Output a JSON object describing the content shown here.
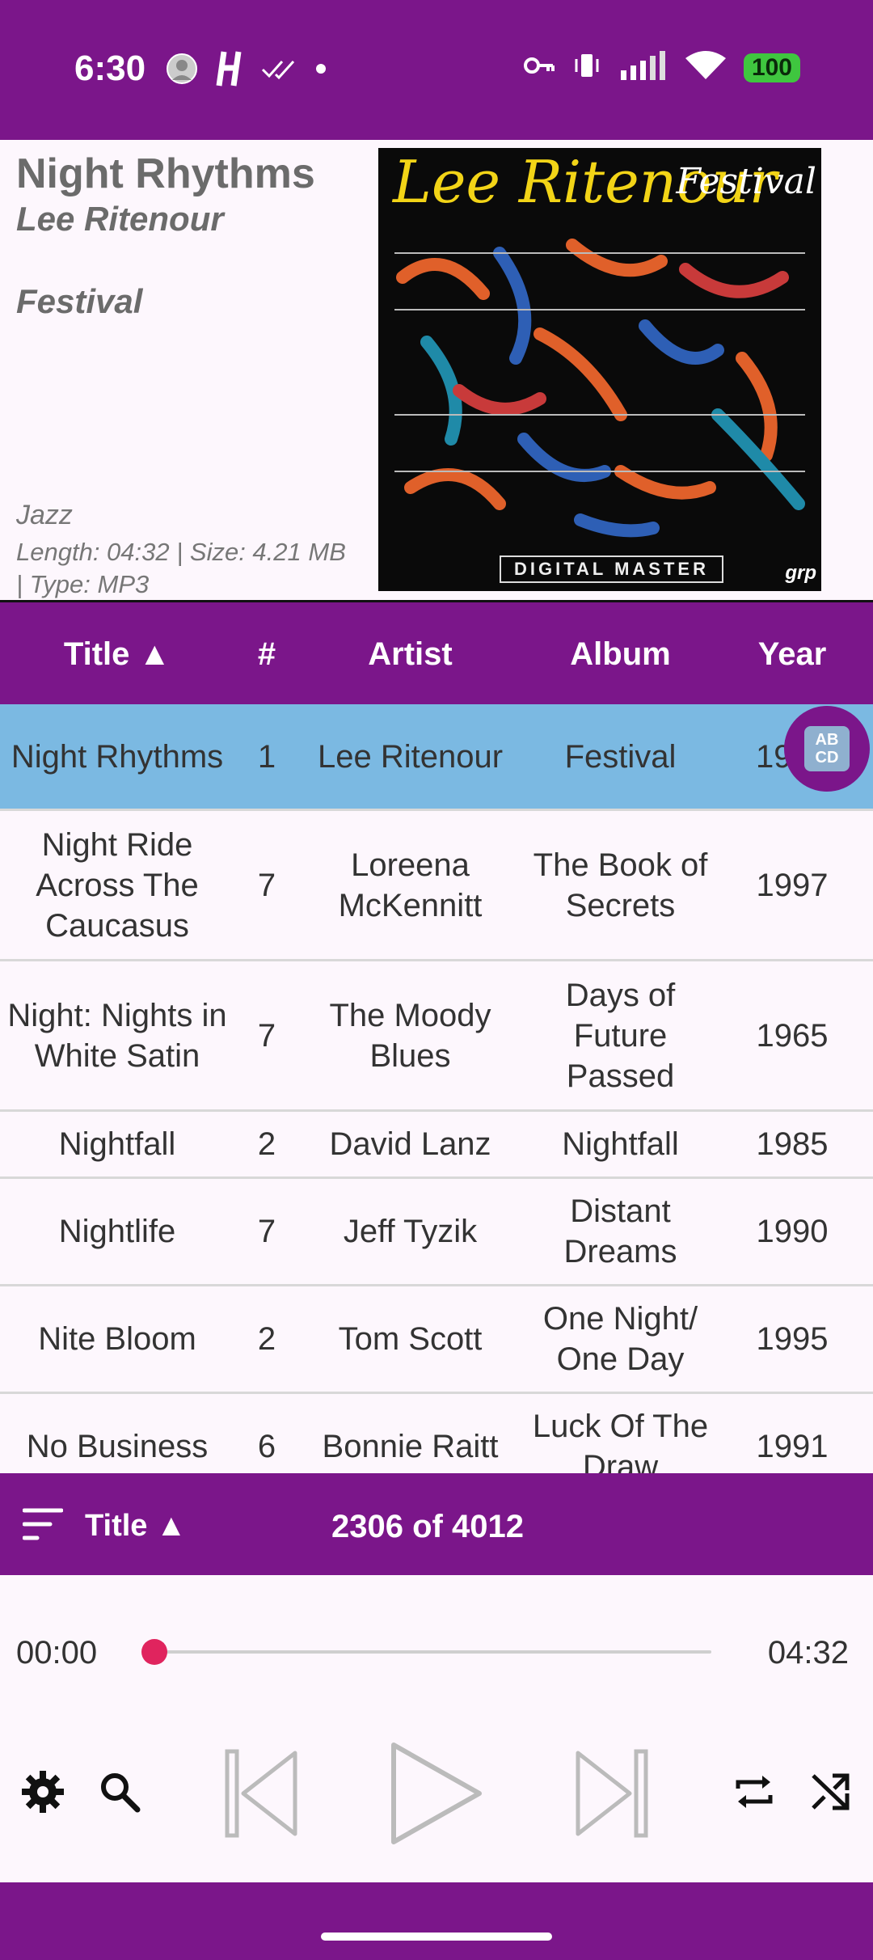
{
  "status_bar": {
    "time": "6:30",
    "battery": "100",
    "icons": [
      "avatar-icon",
      "h-icon",
      "double-check-icon",
      "dot-icon",
      "key-icon",
      "vibrate-icon",
      "signal-icon",
      "wifi-icon",
      "battery-icon",
      "charging-icon"
    ]
  },
  "now_playing": {
    "title": "Night Rhythms",
    "artist": "Lee Ritenour",
    "album": "Festival",
    "genre": "Jazz",
    "meta": "Length: 04:32  |  Size: 4.21 MB  |  Type: MP3",
    "cover": {
      "artist_text": "Lee Ritenour",
      "album_text": "Festival",
      "badge": "DIGITAL MASTER",
      "logo": "grp"
    }
  },
  "table": {
    "columns": [
      "Title ▲",
      "#",
      "Artist",
      "Album",
      "Year"
    ],
    "rows": [
      {
        "title": "Night Rhythms",
        "num": "1",
        "artist": "Lee Ritenour",
        "album": "Festival",
        "year": "19"
      },
      {
        "title": "Night Ride Across The Caucasus",
        "num": "7",
        "artist": "Loreena McKennitt",
        "album": "The Book of Secrets",
        "year": "1997"
      },
      {
        "title": "Night: Nights in White Satin",
        "num": "7",
        "artist": "The Moody Blues",
        "album": "Days of Future Passed",
        "year": "1965"
      },
      {
        "title": "Nightfall",
        "num": "2",
        "artist": "David Lanz",
        "album": "Nightfall",
        "year": "1985"
      },
      {
        "title": "Nightlife",
        "num": "7",
        "artist": "Jeff Tyzik",
        "album": "Distant Dreams",
        "year": "1990"
      },
      {
        "title": "Nite Bloom",
        "num": "2",
        "artist": "Tom Scott",
        "album": "One Night/ One Day",
        "year": "1995"
      },
      {
        "title": "No Business",
        "num": "6",
        "artist": "Bonnie Raitt",
        "album": "Luck Of The Draw",
        "year": "1991"
      }
    ],
    "fab_text": "AB CD"
  },
  "sort_bar": {
    "label": "Title ▲",
    "count": "2306 of 4012"
  },
  "player": {
    "current_time": "00:00",
    "total_time": "04:32",
    "progress": 0.0
  },
  "colors": {
    "primary": "#7B168A",
    "selected_row": "#7BB9E2",
    "accent": "#E0245E"
  }
}
